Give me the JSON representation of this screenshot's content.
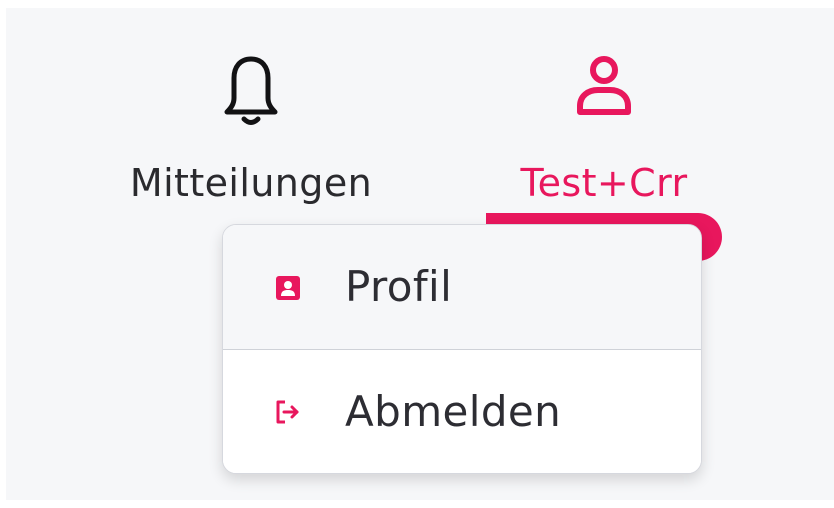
{
  "colors": {
    "accent": "#e8175d",
    "text": "#2a2a2e",
    "panel_background": "#f6f7f9",
    "menu_background": "#ffffff"
  },
  "nav": {
    "notifications": {
      "label": "Mitteilungen",
      "icon": "bell-icon"
    },
    "user": {
      "label": "Test+Crr",
      "icon": "user-icon",
      "active": true
    }
  },
  "user_menu": {
    "items": [
      {
        "label": "Profil",
        "icon": "profile-card-icon"
      },
      {
        "label": "Abmelden",
        "icon": "logout-icon"
      }
    ]
  }
}
